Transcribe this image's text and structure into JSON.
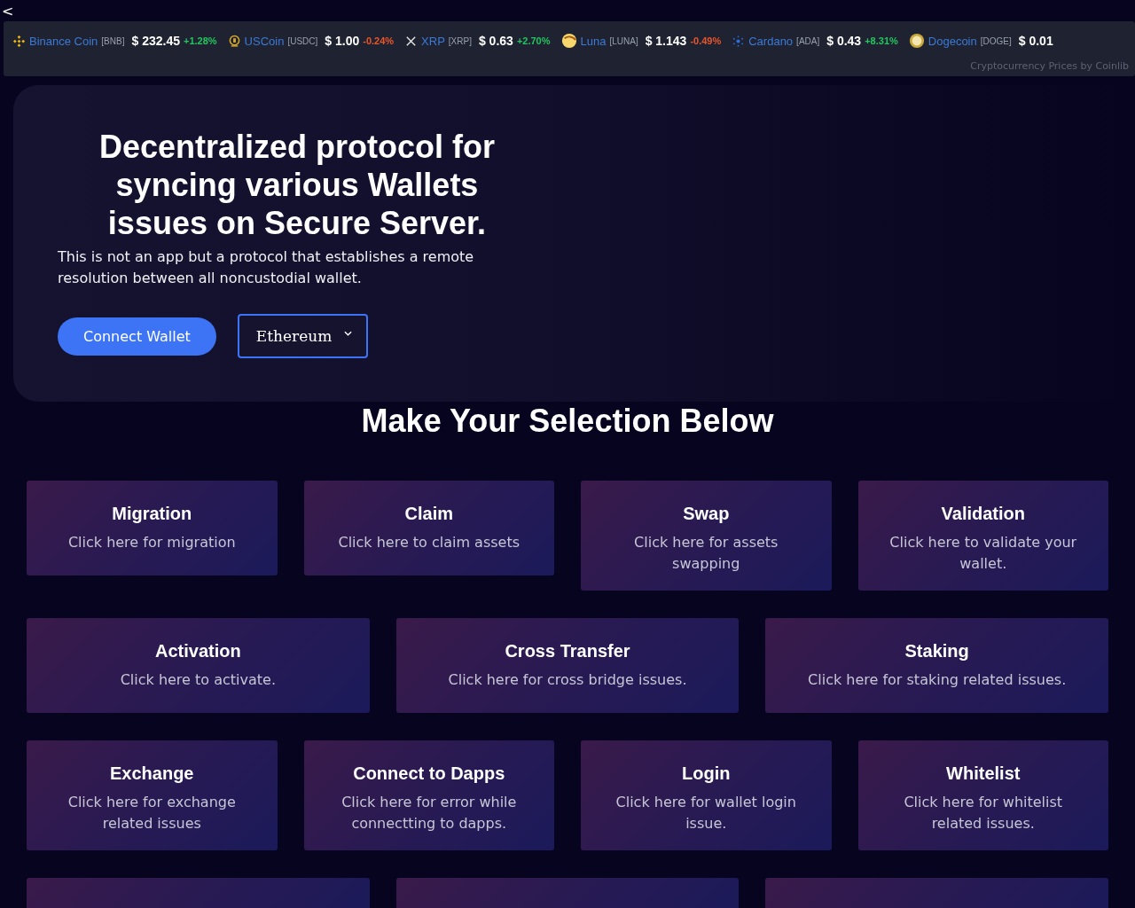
{
  "back_link": "<",
  "ticker": {
    "items": [
      {
        "kind": "diamond",
        "name": "Binance Coin",
        "symbol": "[BNB]",
        "price": "$ 232.45",
        "change": "+1.28%",
        "color": "#22c55e"
      },
      {
        "kind": "coin",
        "name": "USCoin",
        "symbol": "[USDC]",
        "price": "$ 1.00",
        "change": "-0.24%",
        "color": "#e8572c"
      },
      {
        "kind": "cross",
        "name": "XRP",
        "symbol": "[XRP]",
        "price": "$ 0.63",
        "change": "+2.70%",
        "color": "#22c55e"
      },
      {
        "kind": "crescent",
        "name": "Luna",
        "symbol": "[LUNA]",
        "price": "$ 1.143",
        "change": "-0.49%",
        "color": "#e8572c"
      },
      {
        "kind": "dots",
        "name": "Cardano",
        "symbol": "[ADA]",
        "price": "$ 0.43",
        "change": "+8.31%",
        "color": "#22c55e"
      },
      {
        "kind": "face-coin",
        "name": "Dogecoin",
        "symbol": "[DOGE]",
        "price": "$ 0.01"
      }
    ],
    "credit": "Cryptocurrency Prices by Coinlib"
  },
  "hero": {
    "title": "Decentralized protocol for syncing various Wallets issues on Secure Server.",
    "description": "This is not an app but a protocol that establishes a remote resolution between all noncustodial wallet.",
    "connect_button": "Connect Wallet",
    "network_select": "Ethereum"
  },
  "section_title": "Make Your Selection Below",
  "rows": [
    {
      "cards": [
        {
          "title": "Migration",
          "description": "Click here for migration"
        },
        {
          "title": "Claim",
          "description": "Click here to claim assets"
        },
        {
          "title": "Swap",
          "description": "Click here for assets swapping"
        },
        {
          "title": "Validation",
          "description": "Click here to validate your wallet."
        }
      ]
    },
    {
      "cards": [
        {
          "title": "Activation",
          "description": "Click here to activate."
        },
        {
          "title": "Cross Transfer",
          "description": "Click here for cross bridge issues."
        },
        {
          "title": "Staking",
          "description": "Click here for staking related issues."
        }
      ]
    },
    {
      "cards": [
        {
          "title": "Exchange",
          "description": "Click here for exchange related issues"
        },
        {
          "title": "Connect to Dapps",
          "description": "Click here for error while connectting to dapps."
        },
        {
          "title": "Login",
          "description": "Click here for wallet login issue."
        },
        {
          "title": "Whitelist",
          "description": "Click here for whitelist related issues."
        }
      ]
    }
  ]
}
